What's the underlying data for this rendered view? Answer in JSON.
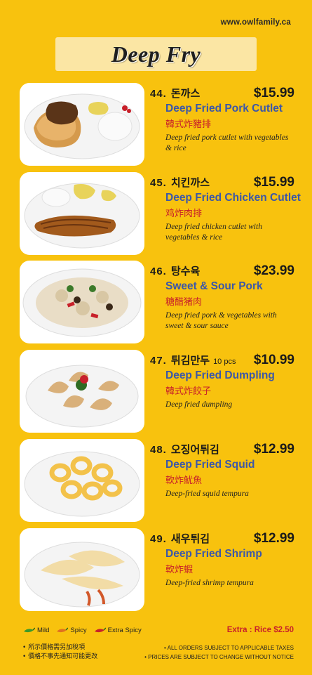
{
  "header": {
    "website": "www.owlfamily.ca",
    "title": "Deep Fry"
  },
  "items": [
    {
      "num": "44.",
      "korean": "돈까스",
      "pcs": "",
      "price": "$15.99",
      "english": "Deep Fried Pork Cutlet",
      "chinese": "韓式炸豬排",
      "desc": "Deep fried pork cutlet with vegetables & rice"
    },
    {
      "num": "45.",
      "korean": "치킨까스",
      "pcs": "",
      "price": "$15.99",
      "english": "Deep Fried Chicken Cutlet",
      "chinese": "鸡炸肉排",
      "desc": "Deep fried chicken cutlet with vegetables & rice"
    },
    {
      "num": "46.",
      "korean": "탕수육",
      "pcs": "",
      "price": "$23.99",
      "english": "Sweet & Sour Pork",
      "chinese": "糖醋猪肉",
      "desc": "Deep fried pork & vegetables with sweet & sour sauce"
    },
    {
      "num": "47.",
      "korean": "튀김만두",
      "pcs": "10 pcs",
      "price": "$10.99",
      "english": "Deep Fried Dumpling",
      "chinese": "韓式炸餃子",
      "desc": "Deep fried dumpling"
    },
    {
      "num": "48.",
      "korean": "오징어튀김",
      "pcs": "",
      "price": "$12.99",
      "english": "Deep Fried Squid",
      "chinese": "軟炸魷魚",
      "desc": "Deep-fried squid tempura"
    },
    {
      "num": "49.",
      "korean": "새우튀김",
      "pcs": "",
      "price": "$12.99",
      "english": "Deep Fried Shrimp",
      "chinese": "軟炸蝦",
      "desc": "Deep-fried shrimp tempura"
    }
  ],
  "legend": {
    "mild": "Mild",
    "spicy": "Spicy",
    "extra_spicy": "Extra Spicy",
    "mild_color": "#3a9a2a",
    "spicy_color": "#e07020",
    "extra_color": "#c8202a"
  },
  "extra": "Extra : Rice $2.50",
  "notes_left": [
    "• 所示價格需另加稅項",
    "• 價格不事先通知可能更改"
  ],
  "notes_right": [
    "• ALL ORDERS SUBJECT TO APPLICABLE TAXES",
    "• PRICES ARE SUBJECT TO CHANGE WITHOUT NOTICE"
  ],
  "colors": {
    "background": "#f8c20e",
    "title_box": "#fbe6a4",
    "english_name": "#3c57a8",
    "chinese_name": "#c8202a"
  }
}
